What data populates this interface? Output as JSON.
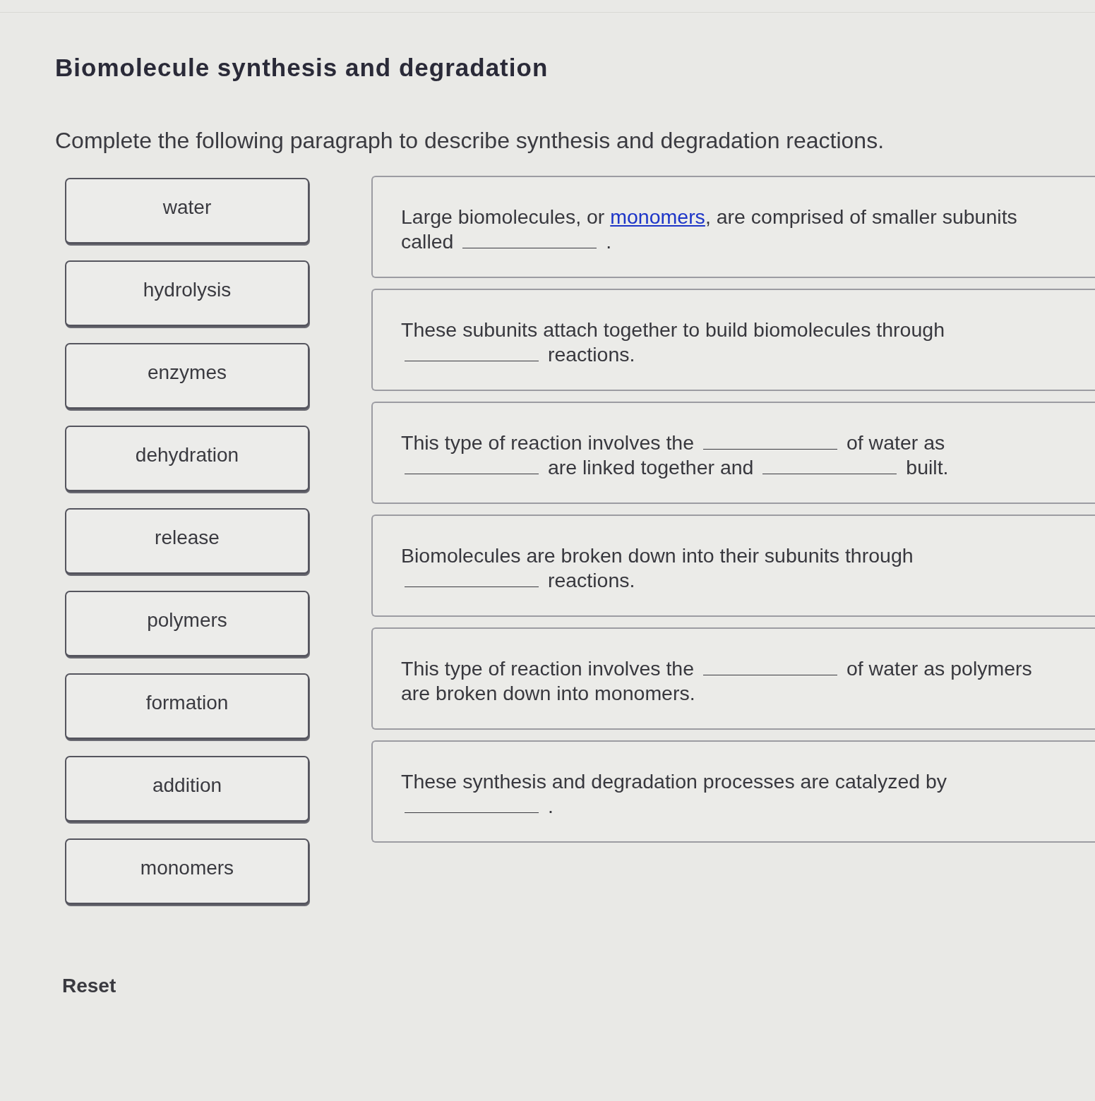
{
  "title": "Biomolecule synthesis and degradation",
  "instructions": "Complete the following paragraph to describe synthesis and degradation reactions.",
  "word_bank": [
    "water",
    "hydrolysis",
    "enzymes",
    "dehydration",
    "release",
    "polymers",
    "formation",
    "addition",
    "monomers"
  ],
  "sentences": [
    {
      "parts": [
        {
          "kind": "text",
          "text": "Large biomolecules, or "
        },
        {
          "kind": "link",
          "text": "monomers"
        },
        {
          "kind": "text",
          "text": ", are comprised of smaller subunits called "
        },
        {
          "kind": "blank"
        },
        {
          "kind": "text",
          "text": " ."
        }
      ]
    },
    {
      "parts": [
        {
          "kind": "text",
          "text": "These subunits attach together to build biomolecules through "
        },
        {
          "kind": "blank"
        },
        {
          "kind": "text",
          "text": " reactions."
        }
      ]
    },
    {
      "parts": [
        {
          "kind": "text",
          "text": "This type of reaction involves the "
        },
        {
          "kind": "blank"
        },
        {
          "kind": "text",
          "text": " of water as "
        },
        {
          "kind": "blank"
        },
        {
          "kind": "text",
          "text": " are linked together and "
        },
        {
          "kind": "blank"
        },
        {
          "kind": "text",
          "text": " built."
        }
      ]
    },
    {
      "parts": [
        {
          "kind": "text",
          "text": "Biomolecules are broken down into their subunits through "
        },
        {
          "kind": "blank"
        },
        {
          "kind": "text",
          "text": " reactions."
        }
      ]
    },
    {
      "parts": [
        {
          "kind": "text",
          "text": "This type of reaction involves the "
        },
        {
          "kind": "blank"
        },
        {
          "kind": "text",
          "text": " of water as polymers are broken down into monomers."
        }
      ]
    },
    {
      "parts": [
        {
          "kind": "text",
          "text": "These synthesis and degradation processes are catalyzed by "
        },
        {
          "kind": "blank"
        },
        {
          "kind": "text",
          "text": " ."
        }
      ]
    }
  ],
  "reset_button": "Reset"
}
